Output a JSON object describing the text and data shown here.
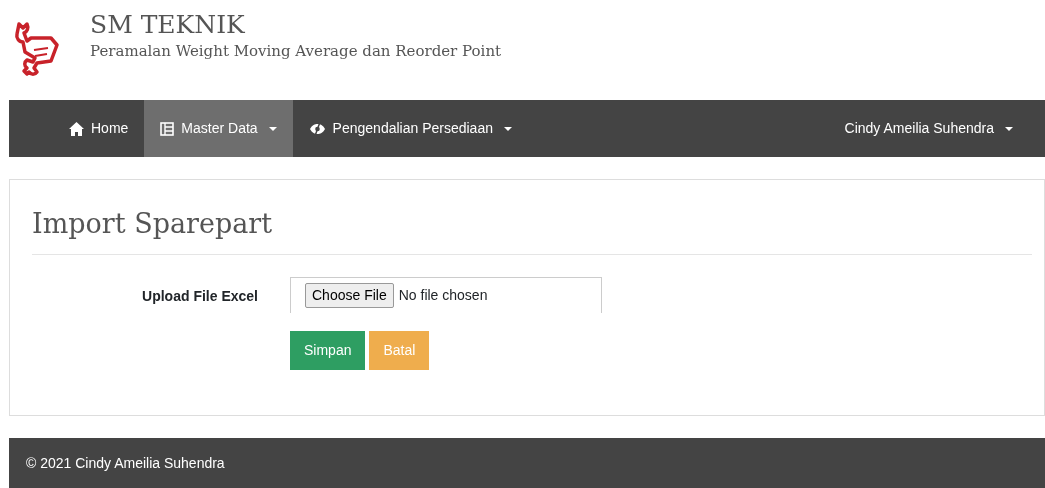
{
  "header": {
    "title": "SM TEKNIK",
    "subtitle": "Peramalan Weight Moving Average dan Reorder Point"
  },
  "nav": {
    "items": [
      {
        "label": "Home",
        "dropdown": false,
        "selected": false
      },
      {
        "label": "Master Data",
        "dropdown": true,
        "selected": true
      },
      {
        "label": "Pengendalian Persediaan",
        "dropdown": true,
        "selected": false
      }
    ],
    "user": {
      "label": "Cindy Ameilia Suhendra",
      "dropdown": true
    }
  },
  "panel": {
    "title": "Import Sparepart",
    "field": {
      "label": "Upload File Excel",
      "button": "Choose File",
      "value": "No file chosen"
    },
    "buttons": [
      {
        "label": "Simpan",
        "kind": "success"
      },
      {
        "label": "Batal",
        "kind": "warning"
      }
    ]
  },
  "footer": {
    "text": "© 2021 Cindy Ameilia Suhendra"
  }
}
